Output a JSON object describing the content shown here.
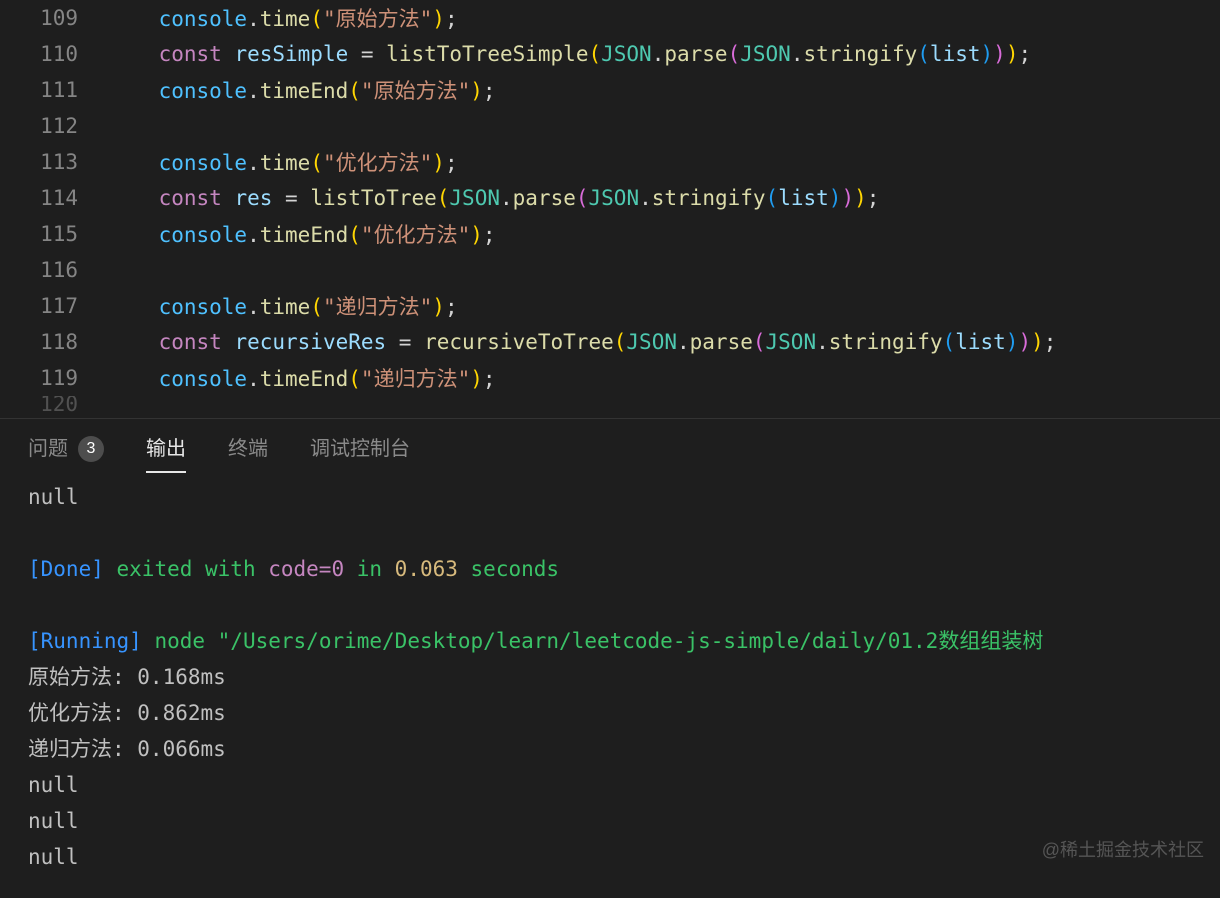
{
  "lineStart": 109,
  "lines": [
    [
      {
        "t": "    ",
        "cls": "tk-punct"
      },
      {
        "t": "console",
        "cls": "tk-obj"
      },
      {
        "t": ".",
        "cls": "tk-punct"
      },
      {
        "t": "time",
        "cls": "tk-fn"
      },
      {
        "t": "(",
        "cls": "tk-paren1"
      },
      {
        "t": "\"原始方法\"",
        "cls": "tk-str"
      },
      {
        "t": ")",
        "cls": "tk-paren1"
      },
      {
        "t": ";",
        "cls": "tk-punct"
      }
    ],
    [
      {
        "t": "    ",
        "cls": "tk-punct"
      },
      {
        "t": "const ",
        "cls": "tk-kw"
      },
      {
        "t": "resSimple",
        "cls": "tk-var"
      },
      {
        "t": " = ",
        "cls": "tk-punct"
      },
      {
        "t": "listToTreeSimple",
        "cls": "tk-fn"
      },
      {
        "t": "(",
        "cls": "tk-paren1"
      },
      {
        "t": "JSON",
        "cls": "tk-cls"
      },
      {
        "t": ".",
        "cls": "tk-punct"
      },
      {
        "t": "parse",
        "cls": "tk-fn"
      },
      {
        "t": "(",
        "cls": "tk-paren2"
      },
      {
        "t": "JSON",
        "cls": "tk-cls"
      },
      {
        "t": ".",
        "cls": "tk-punct"
      },
      {
        "t": "stringify",
        "cls": "tk-fn"
      },
      {
        "t": "(",
        "cls": "tk-paren3"
      },
      {
        "t": "list",
        "cls": "tk-var"
      },
      {
        "t": ")",
        "cls": "tk-paren3"
      },
      {
        "t": ")",
        "cls": "tk-paren2"
      },
      {
        "t": ")",
        "cls": "tk-paren1"
      },
      {
        "t": ";",
        "cls": "tk-punct"
      }
    ],
    [
      {
        "t": "    ",
        "cls": "tk-punct"
      },
      {
        "t": "console",
        "cls": "tk-obj"
      },
      {
        "t": ".",
        "cls": "tk-punct"
      },
      {
        "t": "timeEnd",
        "cls": "tk-fn"
      },
      {
        "t": "(",
        "cls": "tk-paren1"
      },
      {
        "t": "\"原始方法\"",
        "cls": "tk-str"
      },
      {
        "t": ")",
        "cls": "tk-paren1"
      },
      {
        "t": ";",
        "cls": "tk-punct"
      }
    ],
    [],
    [
      {
        "t": "    ",
        "cls": "tk-punct"
      },
      {
        "t": "console",
        "cls": "tk-obj"
      },
      {
        "t": ".",
        "cls": "tk-punct"
      },
      {
        "t": "time",
        "cls": "tk-fn"
      },
      {
        "t": "(",
        "cls": "tk-paren1"
      },
      {
        "t": "\"优化方法\"",
        "cls": "tk-str"
      },
      {
        "t": ")",
        "cls": "tk-paren1"
      },
      {
        "t": ";",
        "cls": "tk-punct"
      }
    ],
    [
      {
        "t": "    ",
        "cls": "tk-punct"
      },
      {
        "t": "const ",
        "cls": "tk-kw"
      },
      {
        "t": "res",
        "cls": "tk-var"
      },
      {
        "t": " = ",
        "cls": "tk-punct"
      },
      {
        "t": "listToTree",
        "cls": "tk-fn"
      },
      {
        "t": "(",
        "cls": "tk-paren1"
      },
      {
        "t": "JSON",
        "cls": "tk-cls"
      },
      {
        "t": ".",
        "cls": "tk-punct"
      },
      {
        "t": "parse",
        "cls": "tk-fn"
      },
      {
        "t": "(",
        "cls": "tk-paren2"
      },
      {
        "t": "JSON",
        "cls": "tk-cls"
      },
      {
        "t": ".",
        "cls": "tk-punct"
      },
      {
        "t": "stringify",
        "cls": "tk-fn"
      },
      {
        "t": "(",
        "cls": "tk-paren3"
      },
      {
        "t": "list",
        "cls": "tk-var"
      },
      {
        "t": ")",
        "cls": "tk-paren3"
      },
      {
        "t": ")",
        "cls": "tk-paren2"
      },
      {
        "t": ")",
        "cls": "tk-paren1"
      },
      {
        "t": ";",
        "cls": "tk-punct"
      }
    ],
    [
      {
        "t": "    ",
        "cls": "tk-punct"
      },
      {
        "t": "console",
        "cls": "tk-obj"
      },
      {
        "t": ".",
        "cls": "tk-punct"
      },
      {
        "t": "timeEnd",
        "cls": "tk-fn"
      },
      {
        "t": "(",
        "cls": "tk-paren1"
      },
      {
        "t": "\"优化方法\"",
        "cls": "tk-str"
      },
      {
        "t": ")",
        "cls": "tk-paren1"
      },
      {
        "t": ";",
        "cls": "tk-punct"
      }
    ],
    [],
    [
      {
        "t": "    ",
        "cls": "tk-punct"
      },
      {
        "t": "console",
        "cls": "tk-obj"
      },
      {
        "t": ".",
        "cls": "tk-punct"
      },
      {
        "t": "time",
        "cls": "tk-fn"
      },
      {
        "t": "(",
        "cls": "tk-paren1"
      },
      {
        "t": "\"递归方法\"",
        "cls": "tk-str"
      },
      {
        "t": ")",
        "cls": "tk-paren1"
      },
      {
        "t": ";",
        "cls": "tk-punct"
      }
    ],
    [
      {
        "t": "    ",
        "cls": "tk-punct"
      },
      {
        "t": "const ",
        "cls": "tk-kw"
      },
      {
        "t": "recursiveRes",
        "cls": "tk-var"
      },
      {
        "t": " = ",
        "cls": "tk-punct"
      },
      {
        "t": "recursiveToTree",
        "cls": "tk-fn"
      },
      {
        "t": "(",
        "cls": "tk-paren1"
      },
      {
        "t": "JSON",
        "cls": "tk-cls"
      },
      {
        "t": ".",
        "cls": "tk-punct"
      },
      {
        "t": "parse",
        "cls": "tk-fn"
      },
      {
        "t": "(",
        "cls": "tk-paren2"
      },
      {
        "t": "JSON",
        "cls": "tk-cls"
      },
      {
        "t": ".",
        "cls": "tk-punct"
      },
      {
        "t": "stringify",
        "cls": "tk-fn"
      },
      {
        "t": "(",
        "cls": "tk-paren3"
      },
      {
        "t": "list",
        "cls": "tk-var"
      },
      {
        "t": ")",
        "cls": "tk-paren3"
      },
      {
        "t": ")",
        "cls": "tk-paren2"
      },
      {
        "t": ")",
        "cls": "tk-paren1"
      },
      {
        "t": ";",
        "cls": "tk-punct"
      }
    ],
    [
      {
        "t": "    ",
        "cls": "tk-punct"
      },
      {
        "t": "console",
        "cls": "tk-obj"
      },
      {
        "t": ".",
        "cls": "tk-punct"
      },
      {
        "t": "timeEnd",
        "cls": "tk-fn"
      },
      {
        "t": "(",
        "cls": "tk-paren1"
      },
      {
        "t": "\"递归方法\"",
        "cls": "tk-str"
      },
      {
        "t": ")",
        "cls": "tk-paren1"
      },
      {
        "t": ";",
        "cls": "tk-punct"
      }
    ]
  ],
  "partialNextLineNumber": "120",
  "panel": {
    "tabs": [
      {
        "id": "problems",
        "label": "问题",
        "badge": "3",
        "active": false
      },
      {
        "id": "output",
        "label": "输出",
        "active": true
      },
      {
        "id": "terminal",
        "label": "终端",
        "active": false
      },
      {
        "id": "debug",
        "label": "调试控制台",
        "active": false
      }
    ]
  },
  "terminal": [
    [
      {
        "t": "null",
        "cls": "c-gray"
      }
    ],
    [],
    [
      {
        "t": "[Done]",
        "cls": "c-blue"
      },
      {
        "t": " ",
        "cls": ""
      },
      {
        "t": "exited with ",
        "cls": "c-green"
      },
      {
        "t": "code=0",
        "cls": "c-purple"
      },
      {
        "t": " in ",
        "cls": "c-green"
      },
      {
        "t": "0.063",
        "cls": "c-yellow"
      },
      {
        "t": " seconds",
        "cls": "c-green"
      }
    ],
    [],
    [
      {
        "t": "[Running]",
        "cls": "c-blue"
      },
      {
        "t": " ",
        "cls": ""
      },
      {
        "t": "node \"/Users/orime/Desktop/learn/leetcode-js-simple/daily/01.2数组组装树",
        "cls": "c-green"
      }
    ],
    [
      {
        "t": "原始方法: 0.168ms",
        "cls": "c-gray"
      }
    ],
    [
      {
        "t": "优化方法: 0.862ms",
        "cls": "c-gray"
      }
    ],
    [
      {
        "t": "递归方法: 0.066ms",
        "cls": "c-gray"
      }
    ],
    [
      {
        "t": "null",
        "cls": "c-gray"
      }
    ],
    [
      {
        "t": "null",
        "cls": "c-gray"
      }
    ],
    [
      {
        "t": "null",
        "cls": "c-gray"
      }
    ]
  ],
  "watermark": "@稀土掘金技术社区"
}
